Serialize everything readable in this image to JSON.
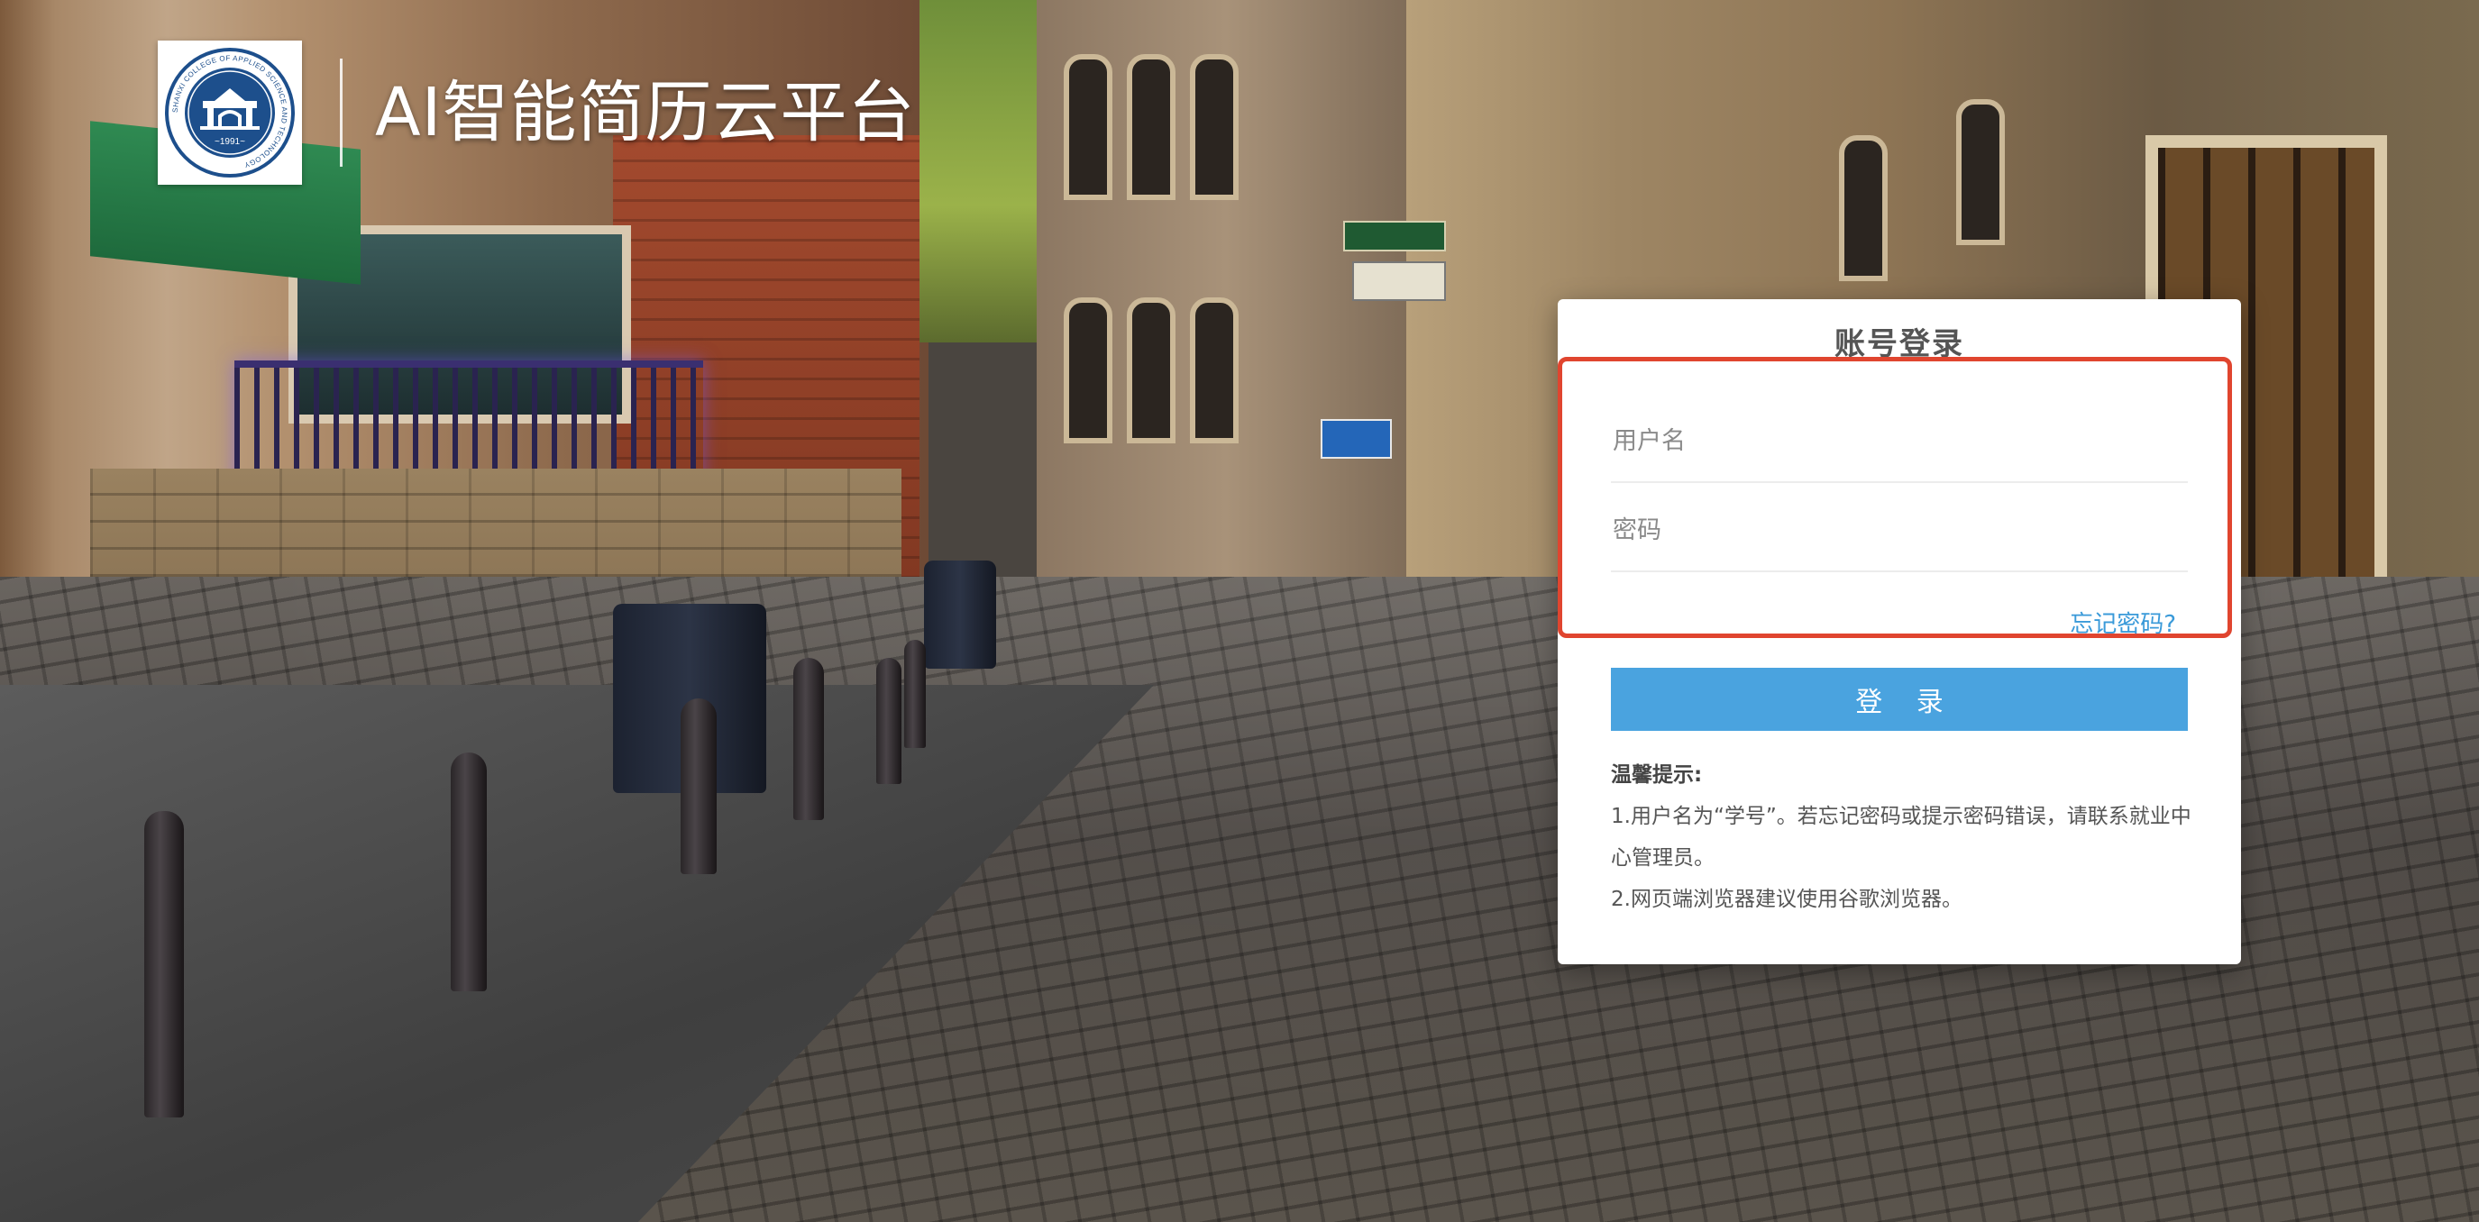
{
  "header": {
    "title": "AI智能简历云平台",
    "logo": {
      "icon": "university-seal-icon",
      "year": "~1991~",
      "ring_text": "SHANXI COLLEGE OF APPLIED SCIENCE AND TECHNOLOGY"
    }
  },
  "login": {
    "title": "账号登录",
    "username_placeholder": "用户名",
    "password_placeholder": "密码",
    "forgot_password": "忘记密码?",
    "submit_label": "登 录",
    "tips": {
      "heading": "温馨提示:",
      "items": [
        "1.用户名为“学号”。若忘记密码或提示密码错误，请联系就业中心管理员。",
        "2.网页端浏览器建议使用谷歌浏览器。"
      ]
    }
  },
  "colors": {
    "accent": "#4aa3df",
    "link": "#3a9ad9",
    "highlight_border": "#e0452f",
    "seal_blue": "#1d4f8c"
  }
}
